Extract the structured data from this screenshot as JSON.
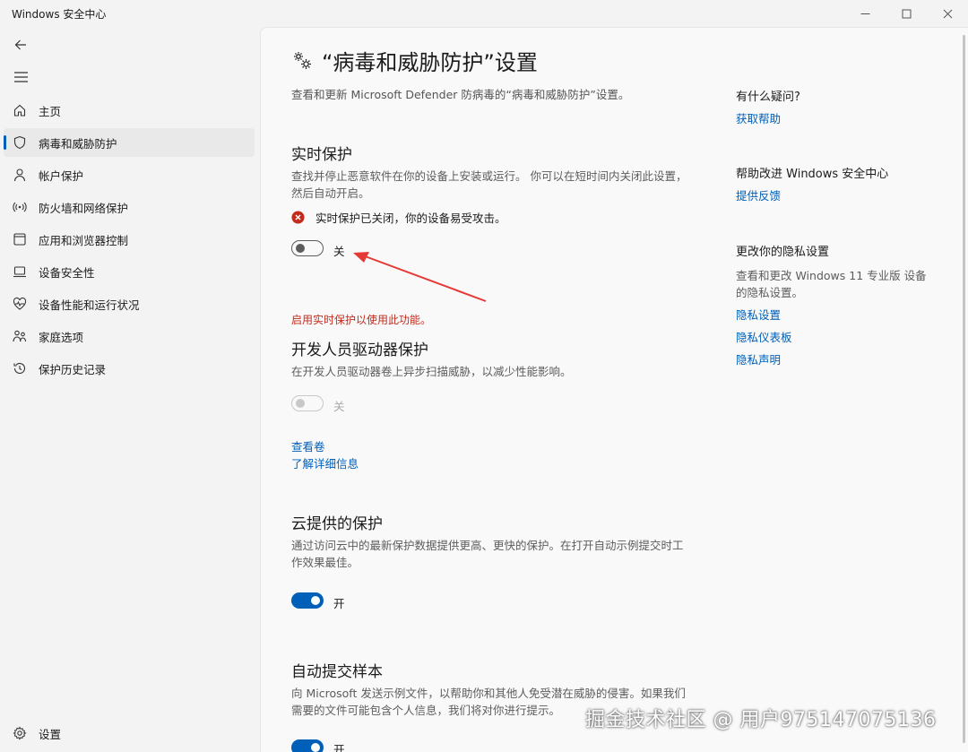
{
  "window": {
    "title": "Windows 安全中心"
  },
  "sidebar": {
    "items": [
      {
        "label": "主页",
        "icon": "home-icon"
      },
      {
        "label": "病毒和威胁防护",
        "icon": "shield-icon",
        "active": true
      },
      {
        "label": "帐户保护",
        "icon": "person-icon"
      },
      {
        "label": "防火墙和网络保护",
        "icon": "antenna-icon"
      },
      {
        "label": "应用和浏览器控制",
        "icon": "window-icon"
      },
      {
        "label": "设备安全性",
        "icon": "laptop-icon"
      },
      {
        "label": "设备性能和运行状况",
        "icon": "heart-icon"
      },
      {
        "label": "家庭选项",
        "icon": "family-icon"
      },
      {
        "label": "保护历史记录",
        "icon": "history-icon"
      }
    ],
    "settings_label": "设置"
  },
  "page": {
    "title": "“病毒和威胁防护”设置",
    "description": "查看和更新 Microsoft Defender 防病毒的“病毒和威胁防护”设置。"
  },
  "realtime": {
    "title": "实时保护",
    "description": "查找并停止恶意软件在你的设备上安装或运行。 你可以在短时间内关闭此设置，然后自动开启。",
    "warning": "实时保护已关闭，你的设备易受攻击。",
    "toggle_label": "关",
    "toggle_on": false,
    "error": "启用实时保护以使用此功能。"
  },
  "dev_drive": {
    "title": "开发人员驱动器保护",
    "description": "在开发人员驱动器卷上异步扫描威胁，以减少性能影响。",
    "toggle_label": "关",
    "toggle_on": false,
    "link_volumes": "查看卷",
    "link_learn": "了解详细信息"
  },
  "cloud": {
    "title": "云提供的保护",
    "description": "通过访问云中的最新保护数据提供更高、更快的保护。在打开自动示例提交时工作效果最佳。",
    "toggle_label": "开",
    "toggle_on": true
  },
  "auto_sample": {
    "title": "自动提交样本",
    "description": "向 Microsoft 发送示例文件，以帮助你和其他人免受潜在威胁的侵害。如果我们需要的文件可能包含个人信息，我们将对你进行提示。",
    "toggle_label": "开",
    "toggle_on": true
  },
  "right_panel": {
    "question_heading": "有什么疑问?",
    "get_help": "获取帮助",
    "improve_heading": "帮助改进 Windows 安全中心",
    "feedback": "提供反馈",
    "privacy_heading": "更改你的隐私设置",
    "privacy_text": "查看和更改 Windows 11 专业版 设备的隐私设置。",
    "privacy_settings": "隐私设置",
    "privacy_dashboard": "隐私仪表板",
    "privacy_statement": "隐私声明"
  },
  "watermark": "掘金技术社区 @ 用户975147075136",
  "colors": {
    "accent": "#005fb8",
    "error": "#c42b1c",
    "annotation_arrow": "#e53935"
  }
}
